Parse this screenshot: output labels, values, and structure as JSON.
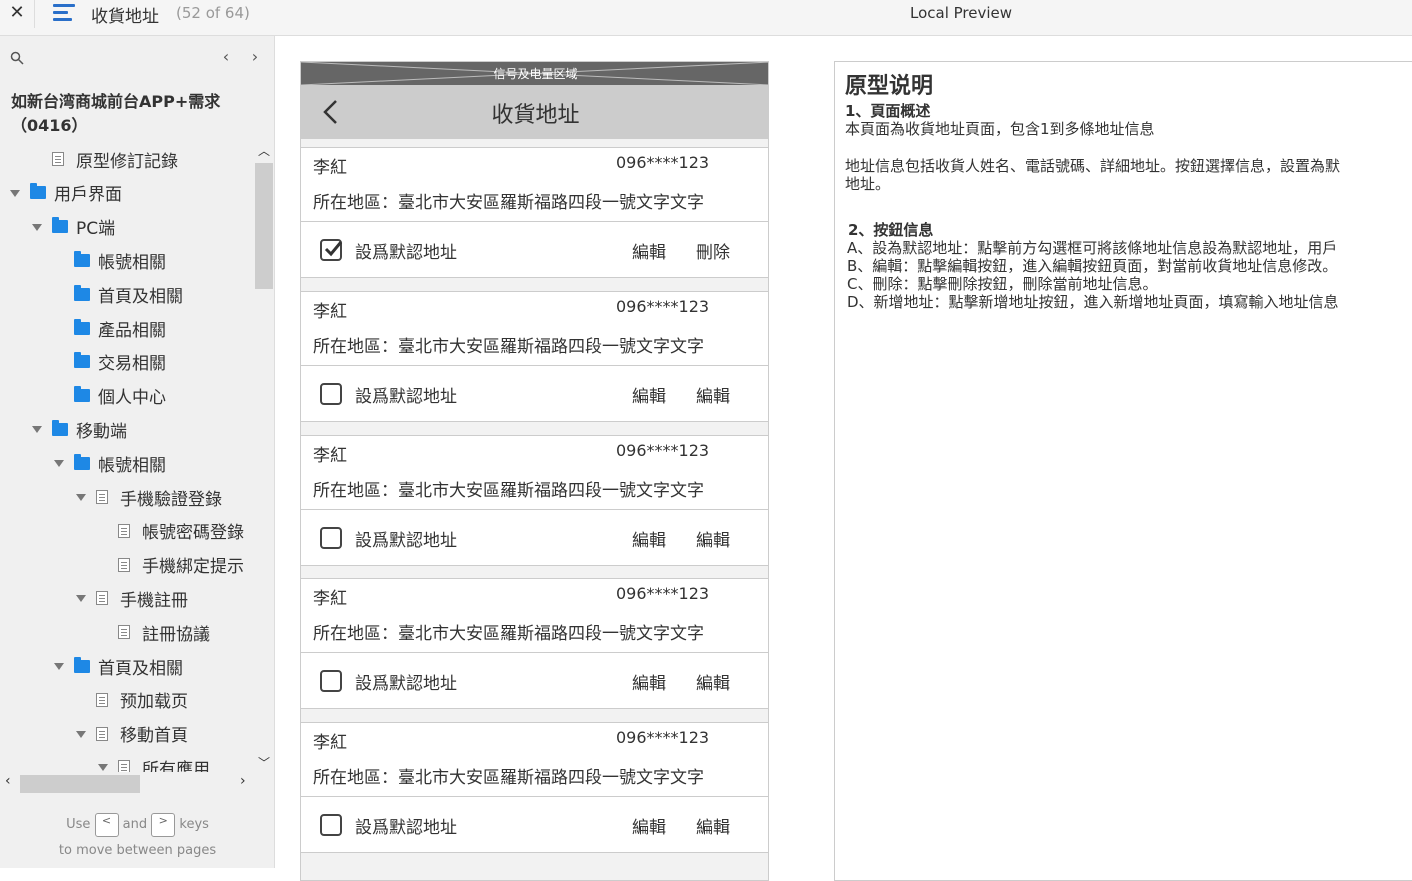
{
  "topbar": {
    "close_label": "✕",
    "page_name": "收貨地址",
    "page_count": "(52 of 64)",
    "preview_title": "Local Preview"
  },
  "sidebar": {
    "project_title": "如新台湾商城前台APP+需求（0416）",
    "tree": [
      {
        "label": "原型修訂記錄",
        "kind": "page",
        "level": 1,
        "caret": false
      },
      {
        "label": "用戶界面",
        "kind": "folder",
        "level": 0,
        "caret": true
      },
      {
        "label": "PC端",
        "kind": "folder",
        "level": 1,
        "caret": true
      },
      {
        "label": "帳號相關",
        "kind": "folder",
        "level": 2,
        "caret": false
      },
      {
        "label": "首頁及相關",
        "kind": "folder",
        "level": 2,
        "caret": false
      },
      {
        "label": "產品相關",
        "kind": "folder",
        "level": 2,
        "caret": false
      },
      {
        "label": "交易相關",
        "kind": "folder",
        "level": 2,
        "caret": false
      },
      {
        "label": "個人中心",
        "kind": "folder",
        "level": 2,
        "caret": false
      },
      {
        "label": "移動端",
        "kind": "folder",
        "level": 1,
        "caret": true
      },
      {
        "label": "帳號相關",
        "kind": "folder",
        "level": 2,
        "caret": true
      },
      {
        "label": "手機驗證登錄",
        "kind": "page",
        "level": 3,
        "caret": true
      },
      {
        "label": "帳號密碼登錄",
        "kind": "page",
        "level": 4,
        "caret": false
      },
      {
        "label": "手機綁定提示",
        "kind": "page",
        "level": 4,
        "caret": false
      },
      {
        "label": "手機註冊",
        "kind": "page",
        "level": 3,
        "caret": true
      },
      {
        "label": "註冊協議",
        "kind": "page",
        "level": 4,
        "caret": false
      },
      {
        "label": "首頁及相關",
        "kind": "folder",
        "level": 2,
        "caret": true
      },
      {
        "label": "预加载页",
        "kind": "page",
        "level": 3,
        "caret": false
      },
      {
        "label": "移動首頁",
        "kind": "page",
        "level": 3,
        "caret": true
      },
      {
        "label": "所有應用",
        "kind": "page",
        "level": 4,
        "caret": true
      }
    ],
    "hint": {
      "use": "Use",
      "and": "and",
      "keys": "keys",
      "line2": "to move between pages",
      "key_prev": "<",
      "key_next": ">"
    }
  },
  "phone": {
    "status_label": "信号及电量区域",
    "nav_title": "收貨地址",
    "addresses": [
      {
        "name": "李紅",
        "phone": "096****123",
        "region": "所在地區：臺北市大安區羅斯福路四段一號文字文字",
        "default_label": "設爲默認地址",
        "checked": true,
        "btn1": "編輯",
        "btn2": "刪除"
      },
      {
        "name": "李紅",
        "phone": "096****123",
        "region": "所在地區：臺北市大安區羅斯福路四段一號文字文字",
        "default_label": "設爲默認地址",
        "checked": false,
        "btn1": "編輯",
        "btn2": "編輯"
      },
      {
        "name": "李紅",
        "phone": "096****123",
        "region": "所在地區：臺北市大安區羅斯福路四段一號文字文字",
        "default_label": "設爲默認地址",
        "checked": false,
        "btn1": "編輯",
        "btn2": "編輯"
      },
      {
        "name": "李紅",
        "phone": "096****123",
        "region": "所在地區：臺北市大安區羅斯福路四段一號文字文字",
        "default_label": "設爲默認地址",
        "checked": false,
        "btn1": "編輯",
        "btn2": "編輯"
      },
      {
        "name": "李紅",
        "phone": "096****123",
        "region": "所在地區：臺北市大安區羅斯福路四段一號文字文字",
        "default_label": "設爲默認地址",
        "checked": false,
        "btn1": "編輯",
        "btn2": "編輯"
      }
    ]
  },
  "notes": {
    "title": "原型说明",
    "lines": [
      {
        "text": "1、頁面概述",
        "bold": true
      },
      {
        "text": "本頁面為收貨地址頁面，包含1到多條地址信息",
        "bold": false
      },
      {
        "text": "地址信息包括收貨人姓名、電話號碼、詳細地址。按鈕選擇信息，設置為默",
        "bold": false
      },
      {
        "text": "地址。",
        "bold": false
      },
      {
        "text": "2、按鈕信息",
        "bold": true
      },
      {
        "text": "A、設為默認地址：點擊前方勾選框可將該條地址信息設為默認地址，用戶",
        "bold": false
      },
      {
        "text": "B、編輯：點擊編輯按鈕，進入編輯按鈕頁面，對當前收貨地址信息修改。",
        "bold": false
      },
      {
        "text": "C、刪除：點擊刪除按鈕，刪除當前地址信息。",
        "bold": false
      },
      {
        "text": "D、新增地址：點擊新增地址按鈕，進入新增地址頁面，填寫輸入地址信息",
        "bold": false
      }
    ]
  },
  "colors": {
    "folder": "#1e88e5",
    "menu_icon": "#2a6fc9",
    "statusbar": "#666666",
    "navbar": "#cccccc"
  }
}
